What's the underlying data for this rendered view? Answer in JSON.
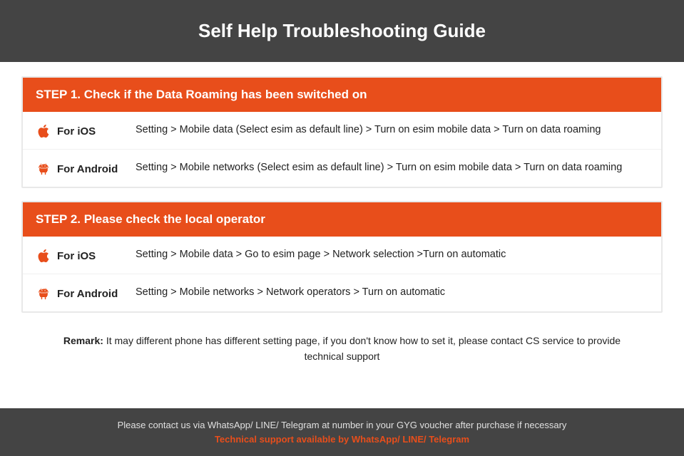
{
  "header": {
    "title": "Self Help Troubleshooting Guide"
  },
  "step1": {
    "heading": "STEP 1.  Check if the Data Roaming has been switched on",
    "ios_label": "For iOS",
    "ios_desc": "Setting > Mobile data (Select esim as default line) > Turn on esim mobile data > Turn on data roaming",
    "android_label": "For Android",
    "android_desc": "Setting > Mobile networks (Select esim as default line) > Turn on esim mobile data > Turn on data roaming"
  },
  "step2": {
    "heading": "STEP 2.  Please check the local operator",
    "ios_label": "For iOS",
    "ios_desc": "Setting > Mobile data > Go to esim page > Network selection >Turn on automatic",
    "android_label": "For Android",
    "android_desc": "Setting > Mobile networks > Network operators > Turn on automatic"
  },
  "remark": {
    "bold": "Remark:",
    "text": " It may different phone has different setting page, if you don't know how to set it,  please contact CS service to provide technical support"
  },
  "footer": {
    "main_text": "Please contact us via WhatsApp/ LINE/ Telegram at number in your GYG voucher after purchase if necessary",
    "support_text": "Technical support available by WhatsApp/ LINE/ Telegram"
  }
}
